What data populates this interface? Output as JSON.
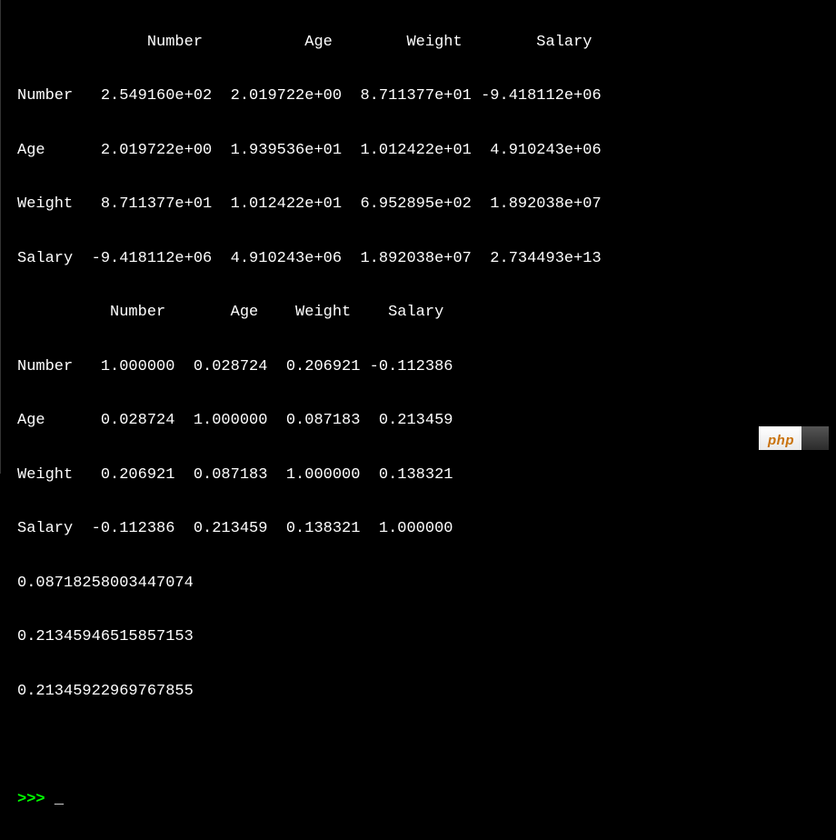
{
  "table1": {
    "header": "              Number           Age        Weight        Salary",
    "rows": [
      "Number   2.549160e+02  2.019722e+00  8.711377e+01 -9.418112e+06",
      "Age      2.019722e+00  1.939536e+01  1.012422e+01  4.910243e+06",
      "Weight   8.711377e+01  1.012422e+01  6.952895e+02  1.892038e+07",
      "Salary  -9.418112e+06  4.910243e+06  1.892038e+07  2.734493e+13"
    ]
  },
  "table2": {
    "header": "          Number       Age    Weight    Salary",
    "rows": [
      "Number   1.000000  0.028724  0.206921 -0.112386",
      "Age      0.028724  1.000000  0.087183  0.213459",
      "Weight   0.206921  0.087183  1.000000  0.138321",
      "Salary  -0.112386  0.213459  0.138321  1.000000"
    ]
  },
  "values": [
    "0.08718258003447074",
    "0.21345946515857153",
    "0.21345922969767855"
  ],
  "prompt": ">>> ",
  "cursor": "_",
  "logo": {
    "left": "php",
    "right": ""
  }
}
